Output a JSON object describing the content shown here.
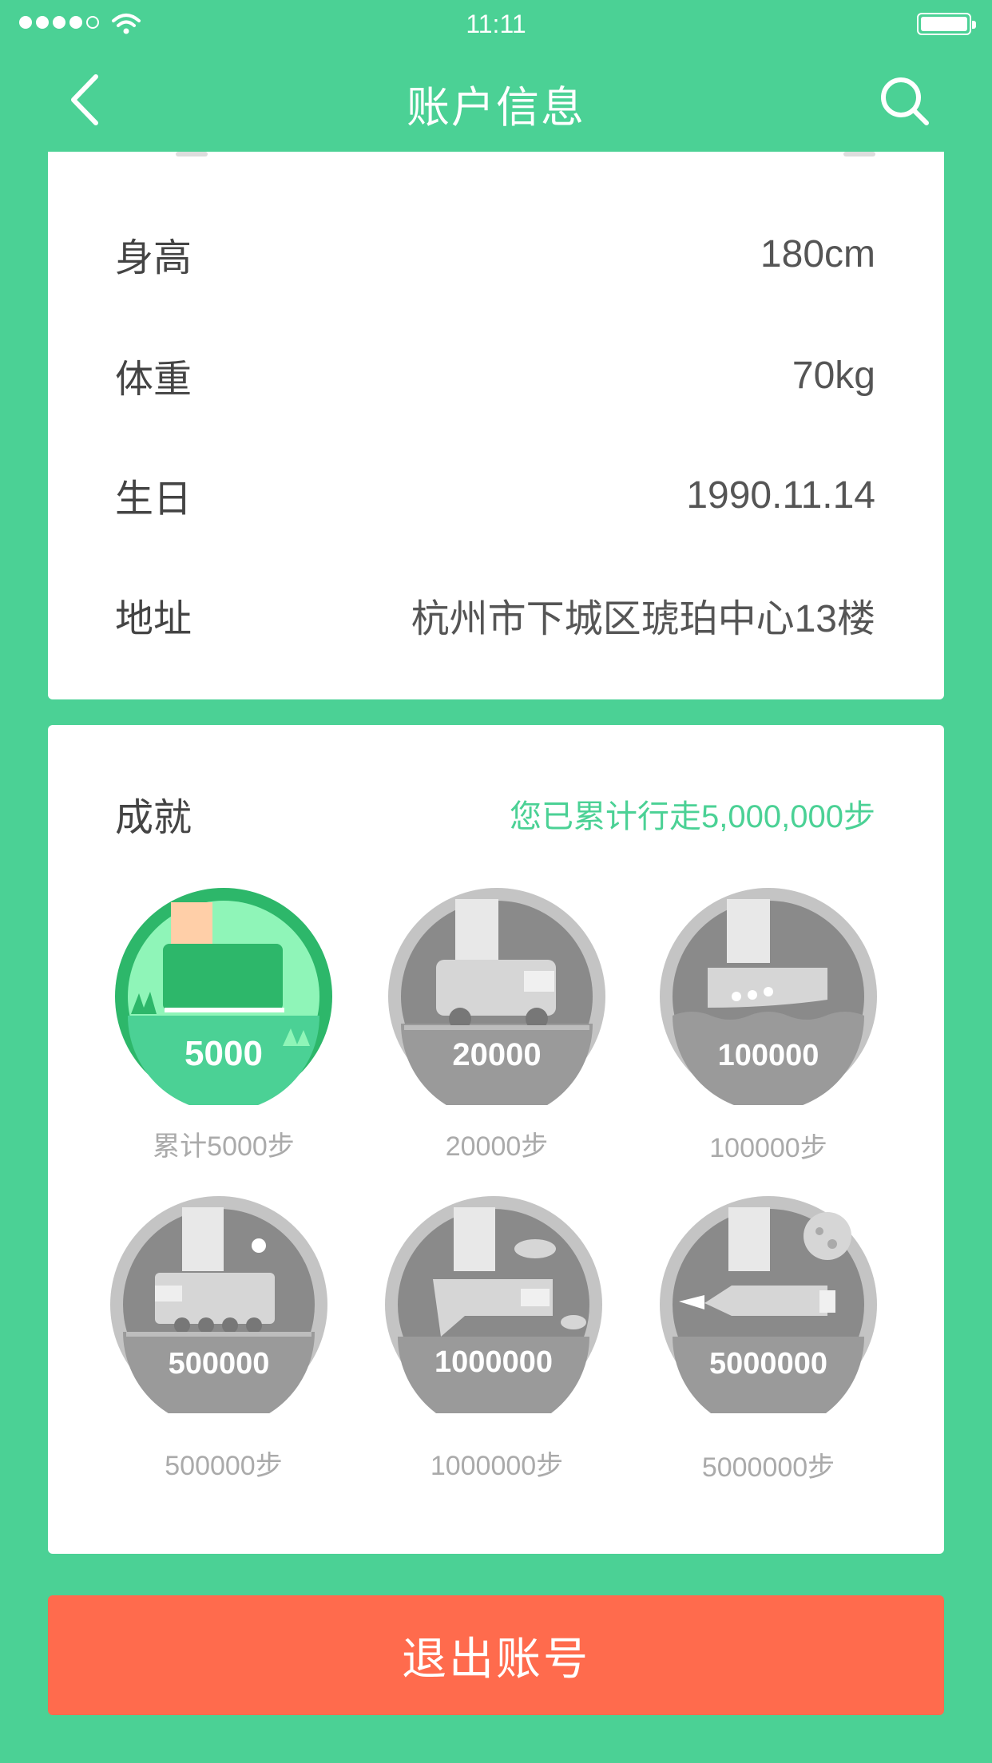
{
  "status_bar": {
    "time": "11:11",
    "signal_bars": 4
  },
  "nav": {
    "title": "账户信息"
  },
  "profile": {
    "rows": [
      {
        "label": "身高",
        "value": "180cm"
      },
      {
        "label": "体重",
        "value": "70kg"
      },
      {
        "label": "生日",
        "value": "1990.11.14"
      },
      {
        "label": "地址",
        "value": "杭州市下城区琥珀中心13楼"
      }
    ]
  },
  "achievements": {
    "title": "成就",
    "total_text": "您已累计行走5,000,000步",
    "badges": [
      {
        "number": "5000",
        "caption": "累计5000步",
        "unlocked": true,
        "icon": "shoe-badge-icon"
      },
      {
        "number": "20000",
        "caption": "20000步",
        "unlocked": false,
        "icon": "car-badge-icon"
      },
      {
        "number": "100000",
        "caption": "100000步",
        "unlocked": false,
        "icon": "boat-badge-icon"
      },
      {
        "number": "500000",
        "caption": "500000步",
        "unlocked": false,
        "icon": "train-badge-icon"
      },
      {
        "number": "1000000",
        "caption": "1000000步",
        "unlocked": false,
        "icon": "airplane-badge-icon"
      },
      {
        "number": "5000000",
        "caption": "5000000步",
        "unlocked": false,
        "icon": "rocket-badge-icon"
      }
    ]
  },
  "logout": {
    "label": "退出账号"
  },
  "colors": {
    "primary": "#4bd195",
    "danger": "#ff6b4d",
    "badge_active": "#2db76a",
    "badge_inactive": "#9a9a9a"
  }
}
